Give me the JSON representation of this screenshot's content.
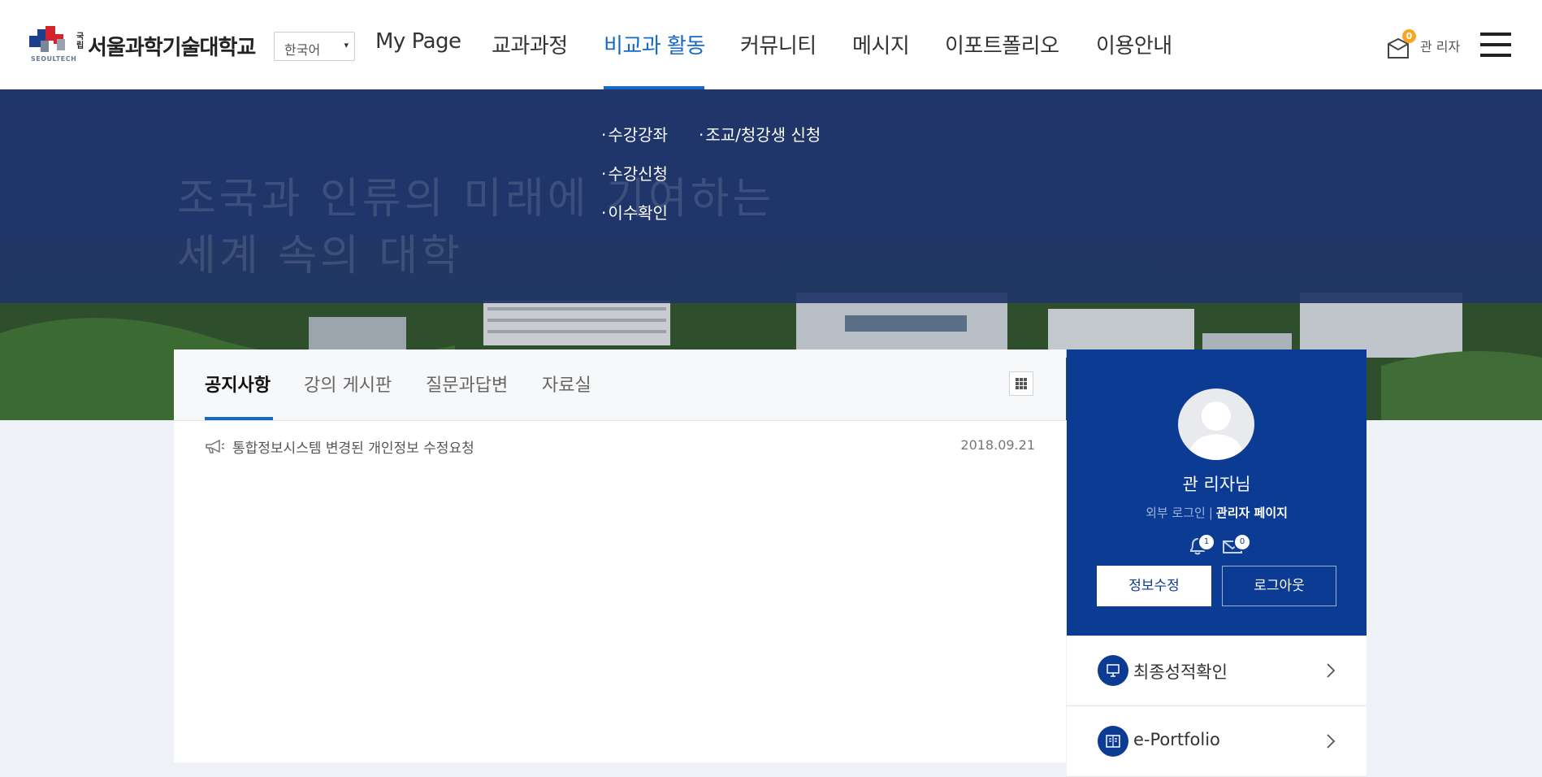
{
  "header": {
    "logo": {
      "sub_label": "SEOULTECH",
      "national_mark": "국립",
      "name": "서울과학기술대학교"
    },
    "language_select": {
      "value": "한국어",
      "arrow": "▾"
    },
    "nav": [
      {
        "label": "My Page",
        "active": false
      },
      {
        "label": "교과과정",
        "active": false
      },
      {
        "label": "비교과 활동",
        "active": true
      },
      {
        "label": "커뮤니티",
        "active": false
      },
      {
        "label": "메시지",
        "active": false
      },
      {
        "label": "이포트폴리오",
        "active": false
      },
      {
        "label": "이용안내",
        "active": false
      }
    ],
    "cart": {
      "icon": "cart-icon",
      "badge": "0",
      "user_label": "관 리자"
    },
    "menu_icon": "hamburger-icon"
  },
  "submenu": {
    "items": [
      "수강강좌",
      "조교/청강생 신청",
      "수강신청",
      "이수확인"
    ]
  },
  "hero": {
    "slogan_line1": "조국과 인류의 미래에 기여하는",
    "slogan_line2": "세계 속의 대학"
  },
  "board": {
    "tabs": [
      {
        "label": "공지사항",
        "active": true
      },
      {
        "label": "강의 게시판",
        "active": false
      },
      {
        "label": "질문과답변",
        "active": false
      },
      {
        "label": "자료실",
        "active": false
      }
    ],
    "grid_icon": "grid-icon",
    "notices": [
      {
        "icon": "megaphone-icon",
        "title": "통합정보시스템 변경된 개인정보 수정요청",
        "date": "2018.09.21"
      }
    ]
  },
  "profile": {
    "name": "관 리자님",
    "external_login": "외부 로그인",
    "separator": "|",
    "admin_page": "관리자 페이지",
    "notification_count": "1",
    "message_count": "0",
    "edit_button": "정보수정",
    "logout_button": "로그아웃"
  },
  "quick_links": [
    {
      "icon": "monitor-icon",
      "label": "최종성적확인"
    },
    {
      "icon": "book-icon",
      "label": "e-Portfolio"
    }
  ],
  "colors": {
    "accent": "#1769c6",
    "navy": "#0c3b94",
    "hero_overlay": "#1f3468",
    "cart_badge": "#f5a623"
  }
}
